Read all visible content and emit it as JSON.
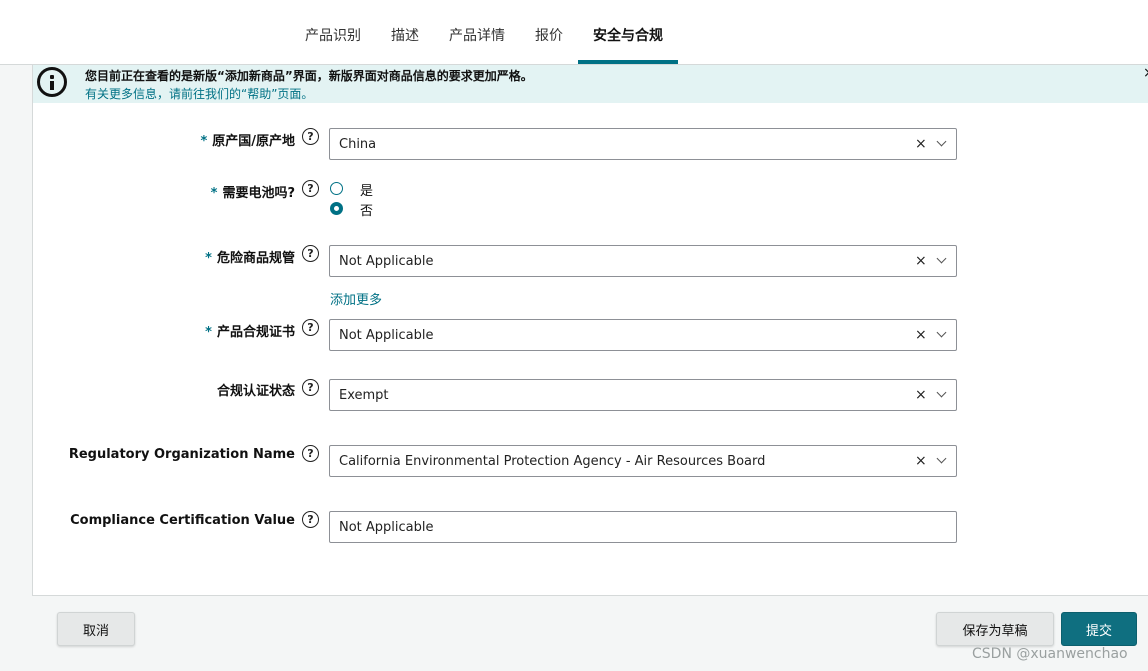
{
  "tabs": [
    {
      "label": "产品识别"
    },
    {
      "label": "描述"
    },
    {
      "label": "产品详情"
    },
    {
      "label": "报价"
    },
    {
      "label": "安全与合规",
      "active": true
    }
  ],
  "notice": {
    "line1": "您目前正在查看的是新版“添加新商品”界面，新版界面对商品信息的要求更加严格。",
    "line2": "有关更多信息，请前往我们的“帮助”页面。",
    "close": "×"
  },
  "form": {
    "required_mark": "*",
    "help_glyph": "?",
    "clear_glyph": "×",
    "country": {
      "label": "原产国/原产地",
      "value": "China"
    },
    "battery": {
      "label": "需要电池吗?",
      "options": [
        "是",
        "否"
      ],
      "selected": "否"
    },
    "dangerous": {
      "label": "危险商品规管",
      "value": "Not Applicable",
      "add_more": "添加更多"
    },
    "certificate": {
      "label": "产品合规证书",
      "value": "Not Applicable"
    },
    "cert_status": {
      "label": "合规认证状态",
      "value": "Exempt"
    },
    "reg_org": {
      "label": "Regulatory Organization Name",
      "value": "California Environmental Protection Agency - Air Resources Board"
    },
    "cert_value": {
      "label": "Compliance Certification Value",
      "value": "Not Applicable"
    }
  },
  "footer": {
    "cancel": "取消",
    "save_draft": "保存为草稿",
    "submit": "提交"
  },
  "watermark": "CSDN @xuanwenchao",
  "colors": {
    "accent": "#007185",
    "submit_bg": "#0f6f80",
    "notice_bg": "#e3f3f3"
  }
}
